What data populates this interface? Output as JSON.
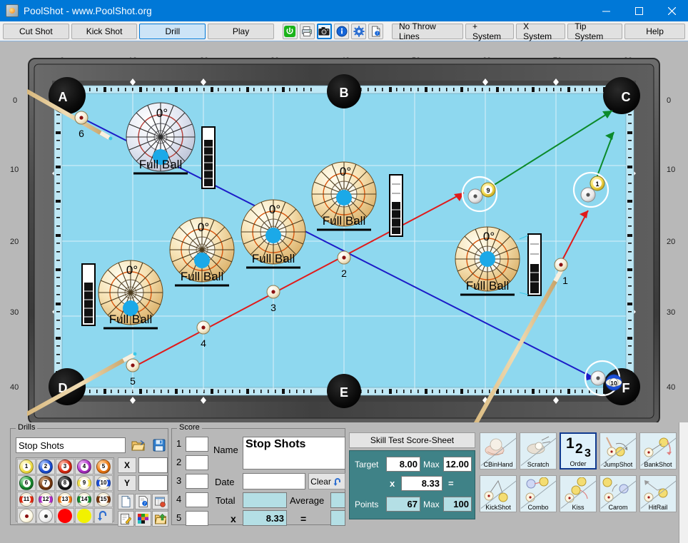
{
  "window": {
    "title": "PoolShot - www.PoolShot.org",
    "icon": "app-logo-icon",
    "minimize": "–",
    "maximize": "□",
    "close": "✕"
  },
  "toolbar": {
    "tabs": [
      {
        "label": "Cut Shot",
        "active": false
      },
      {
        "label": "Kick Shot",
        "active": false
      },
      {
        "label": "Drill",
        "active": true
      },
      {
        "label": "Play",
        "active": false
      }
    ],
    "icons": [
      {
        "name": "power-icon",
        "glyph": "⏻",
        "selected": false
      },
      {
        "name": "print-icon",
        "glyph": "🖨",
        "selected": false
      },
      {
        "name": "camera-icon",
        "glyph": "📷",
        "selected": true
      },
      {
        "name": "info-icon",
        "glyph": "i",
        "selected": false
      },
      {
        "name": "settings-gear-icon",
        "glyph": "⚙",
        "selected": false
      },
      {
        "name": "help-document-icon",
        "glyph": "?",
        "selected": false
      }
    ],
    "systems": [
      {
        "label": "No Throw Lines"
      },
      {
        "label": "+ System"
      },
      {
        "label": "X System"
      },
      {
        "label": "Tip System"
      },
      {
        "label": "Help"
      }
    ]
  },
  "table": {
    "x_axis_labels": [
      "0",
      "10",
      "20",
      "30",
      "40",
      "50",
      "60",
      "70",
      "80"
    ],
    "y_axis_labels": [
      "0",
      "10",
      "20",
      "30",
      "40"
    ],
    "pockets": [
      "A",
      "B",
      "C",
      "D",
      "E",
      "F"
    ],
    "cloth_color": "#8ed8ef",
    "rail_color": "#4a4a4a",
    "aim_targets": [
      {
        "angle": "0°",
        "label": "Full Ball",
        "variant": "white"
      },
      {
        "angle": "0°",
        "label": "Full Ball",
        "variant": "tan"
      },
      {
        "angle": "0°",
        "label": "Full Ball",
        "variant": "tan"
      },
      {
        "angle": "0°",
        "label": "Full Ball",
        "variant": "tan"
      },
      {
        "angle": "0°",
        "label": "Full Ball",
        "variant": "tan"
      },
      {
        "angle": "0°",
        "label": "Full Ball",
        "variant": "tan"
      }
    ],
    "cue_ball_markers": [
      "1",
      "2",
      "3",
      "4",
      "5",
      "6"
    ],
    "object_balls": [
      "9",
      "1",
      "10"
    ],
    "line_colors": {
      "aim_blue": "#1c1cc8",
      "aim_red": "#e01b1b",
      "target_green": "#0b8a2a",
      "cue_stick": "#e8cfa0"
    }
  },
  "drills": {
    "group_title": "Drills",
    "selected_drill": "Stop Shots",
    "open_icon": "open-folder-icon",
    "save_icon": "save-disk-icon",
    "balls": [
      {
        "num": "1",
        "color": "#f2e14c",
        "type": "solid"
      },
      {
        "num": "2",
        "color": "#1b4fd8",
        "type": "solid"
      },
      {
        "num": "3",
        "color": "#e02b12",
        "type": "solid"
      },
      {
        "num": "4",
        "color": "#b030c8",
        "type": "solid"
      },
      {
        "num": "5",
        "color": "#f07a12",
        "type": "solid"
      },
      {
        "num": "6",
        "color": "#178b2e",
        "type": "solid"
      },
      {
        "num": "7",
        "color": "#7a3a10",
        "type": "solid"
      },
      {
        "num": "8",
        "color": "#1a1a1a",
        "type": "solid"
      },
      {
        "num": "9",
        "color": "#f2e14c",
        "type": "stripe"
      },
      {
        "num": "10",
        "color": "#1b4fd8",
        "type": "stripe"
      },
      {
        "num": "11",
        "color": "#e02b12",
        "type": "stripe"
      },
      {
        "num": "12",
        "color": "#b030c8",
        "type": "stripe"
      },
      {
        "num": "13",
        "color": "#f07a12",
        "type": "stripe"
      },
      {
        "num": "14",
        "color": "#178b2e",
        "type": "stripe"
      },
      {
        "num": "15",
        "color": "#7a3a10",
        "type": "stripe"
      },
      {
        "num": "",
        "color": "#fffbe8",
        "type": "cueball-red"
      },
      {
        "num": "",
        "color": "#ffffff",
        "type": "cueball-black"
      },
      {
        "num": "",
        "color": "#ff0000",
        "type": "plain"
      },
      {
        "num": "",
        "color": "#f2f200",
        "type": "plain"
      },
      {
        "num": "",
        "color": "#e9e9e9",
        "type": "undo"
      }
    ],
    "coord_labels": {
      "x": "X",
      "y": "Y"
    },
    "coord_values": {
      "x": "",
      "y": ""
    },
    "tool_icons": [
      {
        "name": "new-document-icon"
      },
      {
        "name": "help-document-icon"
      },
      {
        "name": "table-report-icon"
      },
      {
        "name": "edit-note-icon"
      },
      {
        "name": "color-palette-icon"
      },
      {
        "name": "export-folder-icon"
      }
    ]
  },
  "score": {
    "group_title": "Score",
    "rows": [
      "1",
      "2",
      "3",
      "4",
      "5"
    ],
    "row_values": [
      "",
      "",
      "",
      "",
      ""
    ],
    "name_label": "Name",
    "name_value": "Stop Shots",
    "date_label": "Date",
    "date_value": "",
    "clear_label": "Clear",
    "clear_icon": "undo-arrow-icon",
    "total_label": "Total",
    "total_value": "",
    "average_label": "Average",
    "average_value": "",
    "mult_label": "x",
    "mult_value": "8.33",
    "eq_label": "=",
    "eq_value": ""
  },
  "skill_test": {
    "header": "Skill Test Score-Sheet",
    "target_label": "Target",
    "target_value": "8.00",
    "target_max_label": "Max",
    "target_max_value": "12.00",
    "mult_label": "x",
    "mult_value": "8.33",
    "eq_label": "=",
    "points_label": "Points",
    "points_value": "67",
    "points_max_label": "Max",
    "points_max_value": "100"
  },
  "shot_types": [
    {
      "label": "CBinHand",
      "selected": false
    },
    {
      "label": "Scratch",
      "selected": false
    },
    {
      "label": "Order",
      "selected": true
    },
    {
      "label": "JumpShot",
      "selected": false
    },
    {
      "label": "BankShot",
      "selected": false
    },
    {
      "label": "KickShot",
      "selected": false
    },
    {
      "label": "Combo",
      "selected": false
    },
    {
      "label": "Kiss",
      "selected": false
    },
    {
      "label": "Carom",
      "selected": false
    },
    {
      "label": "HitRail",
      "selected": false
    }
  ],
  "order_icon_digits": [
    "1",
    "2",
    "3"
  ]
}
